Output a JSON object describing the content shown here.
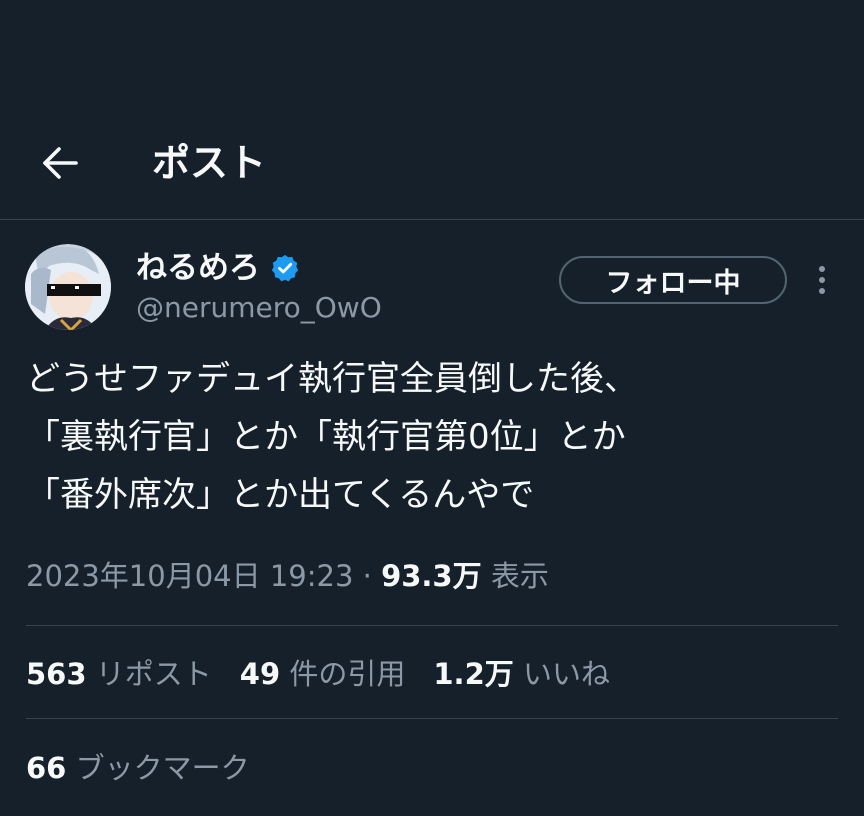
{
  "header": {
    "title": "ポスト",
    "back_icon": "arrow-left-icon"
  },
  "author": {
    "display_name": "ねるめろ",
    "handle": "@nerumero_OwO",
    "verified": true,
    "verified_color": "#1d9bf0"
  },
  "follow_button": {
    "label": "フォロー中"
  },
  "tweet": {
    "lines": [
      "どうせファデュイ執行官全員倒した後、",
      "「裏執行官」とか「執行官第0位」とか",
      "「番外席次」とか出てくるんやで"
    ]
  },
  "meta": {
    "timestamp": "2023年10月04日 19:23",
    "separator": "·",
    "views_count": "93.3万",
    "views_label": "表示"
  },
  "stats": {
    "reposts": {
      "count": "563",
      "label": "リポスト"
    },
    "quotes": {
      "count": "49",
      "label": "件の引用"
    },
    "likes": {
      "count": "1.2万",
      "label": "いいね"
    },
    "bookmarks": {
      "count": "66",
      "label": "ブックマーク"
    }
  },
  "colors": {
    "background": "#15202b",
    "text_primary": "#f7f9f9",
    "text_secondary": "#8b98a5",
    "border": "#38444d",
    "accent": "#1d9bf0"
  }
}
